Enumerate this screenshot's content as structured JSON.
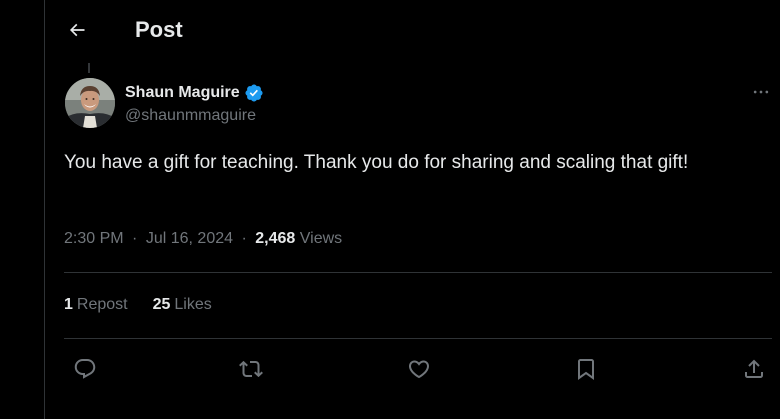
{
  "header": {
    "title": "Post",
    "back_icon": "arrow-left-icon"
  },
  "post": {
    "author": {
      "name": "Shaun Maguire",
      "handle": "@shaunmmaguire",
      "verified": true,
      "verified_color": "#1d9bf0"
    },
    "text": "You have a gift for teaching. Thank you do for sharing and scaling that gift!",
    "meta": {
      "time": "2:30 PM",
      "separator": "·",
      "date": "Jul 16, 2024",
      "views_count": "2,468",
      "views_label": "Views"
    },
    "stats": {
      "reposts_count": "1",
      "reposts_label": "Repost",
      "likes_count": "25",
      "likes_label": "Likes"
    },
    "actions": [
      {
        "name": "reply",
        "icon": "reply-icon"
      },
      {
        "name": "repost",
        "icon": "repost-icon"
      },
      {
        "name": "like",
        "icon": "heart-icon"
      },
      {
        "name": "bookmark",
        "icon": "bookmark-icon"
      },
      {
        "name": "share",
        "icon": "share-icon"
      }
    ]
  },
  "colors": {
    "background": "#000000",
    "text_primary": "#e7e9ea",
    "text_secondary": "#71767b",
    "divider": "#2f3336",
    "accent": "#1d9bf0"
  }
}
